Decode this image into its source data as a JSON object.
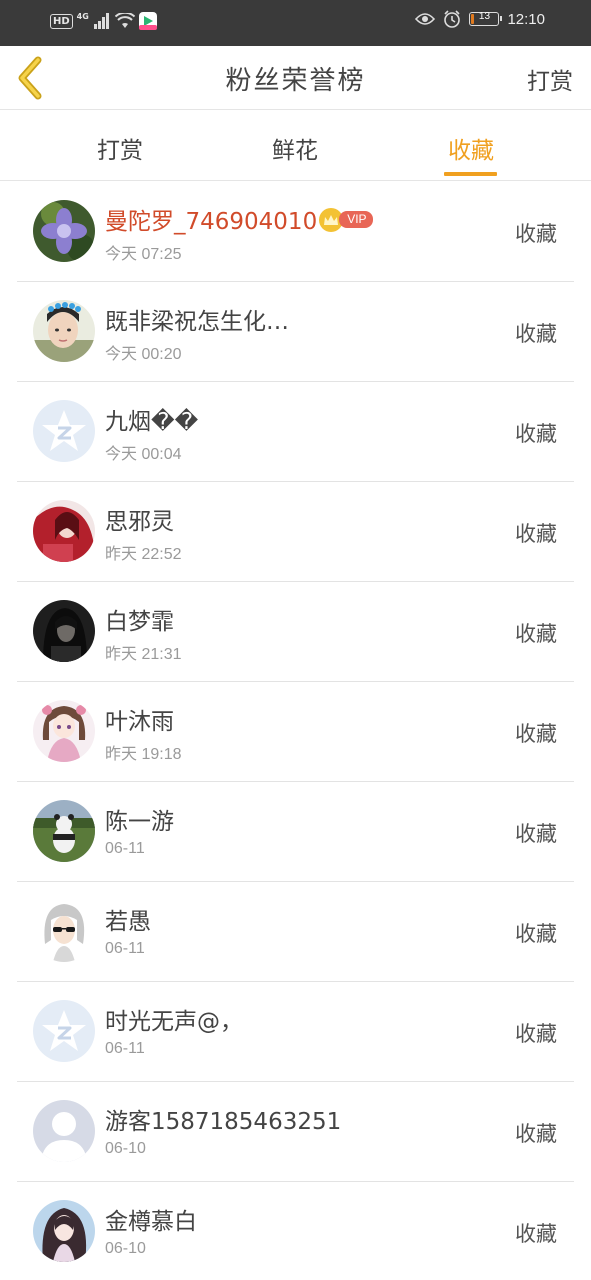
{
  "status_bar": {
    "left_badge": "HD",
    "network": "4G",
    "battery": "13",
    "battery_fraction": 0.13,
    "time": "12:10"
  },
  "header": {
    "title": "粉丝荣誉榜",
    "action_label": "打赏",
    "back_icon": "chevron-left-icon"
  },
  "tabs": [
    {
      "label": "打赏",
      "active": false
    },
    {
      "label": "鲜花",
      "active": false
    },
    {
      "label": "收藏",
      "active": true
    }
  ],
  "colors": {
    "accent": "#f0a020",
    "vip_name": "#d14b2a",
    "status_bar": "#3a3a3a"
  },
  "list": [
    {
      "name": "曼陀罗_746904010",
      "vip": true,
      "vip_label": "VIP",
      "time": "今天 07:25",
      "action": "收藏",
      "avatar": "flower-photo"
    },
    {
      "name": "既非梁祝怎生化…",
      "vip": false,
      "time": "今天 00:20",
      "action": "收藏",
      "avatar": "selfie-photo"
    },
    {
      "name": "九烟��",
      "vip": false,
      "time": "今天 00:04",
      "action": "收藏",
      "avatar": "default-star"
    },
    {
      "name": "思邪灵",
      "vip": false,
      "time": "昨天 22:52",
      "action": "收藏",
      "avatar": "red-anime"
    },
    {
      "name": "白梦霏",
      "vip": false,
      "time": "昨天 21:31",
      "action": "收藏",
      "avatar": "dark-photo"
    },
    {
      "name": "叶沐雨",
      "vip": false,
      "time": "昨天 19:18",
      "action": "收藏",
      "avatar": "anime-girl"
    },
    {
      "name": "陈一游",
      "vip": false,
      "time": "06-11",
      "action": "收藏",
      "avatar": "panda-field"
    },
    {
      "name": "若愚",
      "vip": false,
      "time": "06-11",
      "action": "收藏",
      "avatar": "silver-hair"
    },
    {
      "name": "时光无声@，",
      "vip": false,
      "time": "06-11",
      "action": "收藏",
      "avatar": "default-star"
    },
    {
      "name": "游客1587185463251",
      "vip": false,
      "time": "06-10",
      "action": "收藏",
      "avatar": "default-person"
    },
    {
      "name": "金樽慕白",
      "vip": false,
      "time": "06-10",
      "action": "收藏",
      "avatar": "long-hair-girl"
    }
  ]
}
